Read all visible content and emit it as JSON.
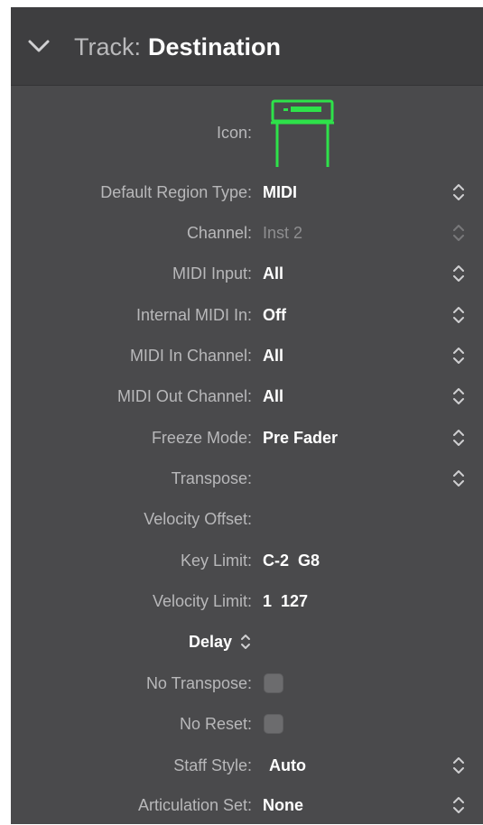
{
  "header": {
    "prefix": "Track:",
    "track_name": "Destination"
  },
  "icon_row": {
    "label": "Icon:",
    "icon_name": "keyboard-stand-icon",
    "icon_color": "#2ee24a"
  },
  "rows": [
    {
      "label": "Default Region Type:",
      "value": "MIDI"
    },
    {
      "label": "Channel:",
      "value": "Inst 2",
      "disabled": true
    },
    {
      "label": "MIDI Input:",
      "value": "All"
    },
    {
      "label": "Internal MIDI In:",
      "value": "Off"
    },
    {
      "label": "MIDI In Channel:",
      "value": "All"
    },
    {
      "label": "MIDI Out Channel:",
      "value": "All"
    },
    {
      "label": "Freeze Mode:",
      "value": "Pre Fader"
    },
    {
      "label": "Transpose:",
      "value": ""
    },
    {
      "label": "Velocity Offset:",
      "value": ""
    },
    {
      "label": "Key Limit:",
      "value": "C-2  G8"
    },
    {
      "label": "Velocity Limit:",
      "value": "1  127"
    },
    {
      "label": "Delay",
      "value": ""
    },
    {
      "label": "No Transpose:",
      "checked": false
    },
    {
      "label": "No Reset:",
      "checked": false
    },
    {
      "label": "Staff Style:",
      "value": "Auto"
    },
    {
      "label": "Articulation Set:",
      "value": "None"
    }
  ],
  "colors": {
    "panel_bg": "#4a4a4c",
    "header_bg": "#3e3e40",
    "label_text": "#b8b8ba",
    "value_text": "#ffffff",
    "icon_green": "#2ee24a"
  }
}
